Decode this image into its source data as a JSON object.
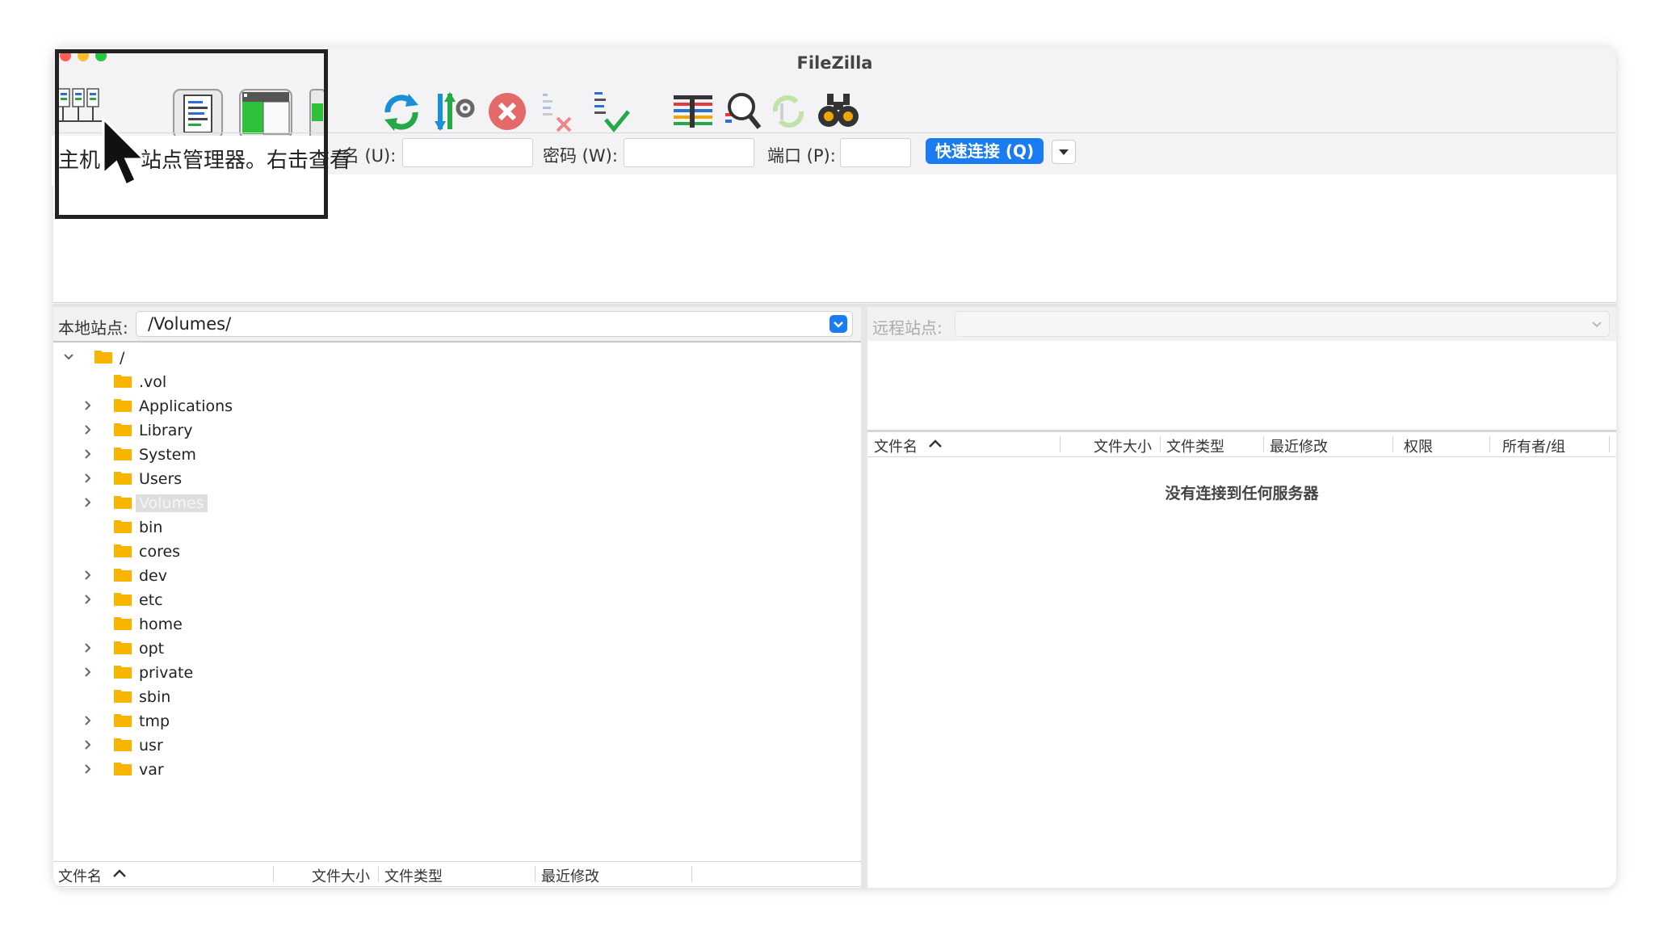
{
  "window": {
    "title": "FileZilla"
  },
  "toolbar": {
    "buttons": [
      {
        "name": "site-manager-button",
        "icon": "site-manager-icon"
      },
      {
        "name": "toggle-message-log-button",
        "icon": "message-log-icon"
      },
      {
        "name": "toggle-directory-tree-button",
        "icon": "directory-tree-icon"
      },
      {
        "name": "toggle-transfer-queue-button",
        "icon": "transfer-queue-icon"
      },
      {
        "name": "refresh-button",
        "icon": "refresh-icon"
      },
      {
        "name": "process-queue-button",
        "icon": "process-queue-icon"
      },
      {
        "name": "cancel-operation-button",
        "icon": "cancel-icon"
      },
      {
        "name": "disconnect-button",
        "icon": "disconnect-icon"
      },
      {
        "name": "reconnect-button",
        "icon": "reconnect-icon"
      },
      {
        "name": "directory-filters-button",
        "icon": "filter-icon"
      },
      {
        "name": "toggle-filename-filter-button",
        "icon": "search-icon"
      },
      {
        "name": "sync-browsing-button",
        "icon": "sync-icon"
      },
      {
        "name": "search-remote-files-button",
        "icon": "binoculars-icon"
      }
    ]
  },
  "tooltip": {
    "host_label": "主机",
    "text": "站点管理器。右击查看"
  },
  "quickconnect": {
    "username_label": "'名 (U):",
    "password_label": "密码 (W):",
    "port_label": "端口 (P):",
    "connect_label": "快速连接 (Q)",
    "username_value": "",
    "password_value": "",
    "port_value": ""
  },
  "local": {
    "site_label": "本地站点:",
    "path": "/Volumes/",
    "tree": [
      {
        "label": "/",
        "level": 0,
        "expanded": true,
        "has_children": true
      },
      {
        "label": ".vol",
        "level": 1,
        "has_children": false
      },
      {
        "label": "Applications",
        "level": 1,
        "has_children": true
      },
      {
        "label": "Library",
        "level": 1,
        "has_children": true
      },
      {
        "label": "System",
        "level": 1,
        "has_children": true
      },
      {
        "label": "Users",
        "level": 1,
        "has_children": true
      },
      {
        "label": "Volumes",
        "level": 1,
        "has_children": true,
        "selected": true
      },
      {
        "label": "bin",
        "level": 1,
        "has_children": false
      },
      {
        "label": "cores",
        "level": 1,
        "has_children": false
      },
      {
        "label": "dev",
        "level": 1,
        "has_children": true
      },
      {
        "label": "etc",
        "level": 1,
        "has_children": true
      },
      {
        "label": "home",
        "level": 1,
        "has_children": false
      },
      {
        "label": "opt",
        "level": 1,
        "has_children": true
      },
      {
        "label": "private",
        "level": 1,
        "has_children": true
      },
      {
        "label": "sbin",
        "level": 1,
        "has_children": false
      },
      {
        "label": "tmp",
        "level": 1,
        "has_children": true
      },
      {
        "label": "usr",
        "level": 1,
        "has_children": true
      },
      {
        "label": "var",
        "level": 1,
        "has_children": true
      }
    ],
    "columns": {
      "name": "文件名",
      "size": "文件大小",
      "type": "文件类型",
      "modified": "最近修改"
    }
  },
  "remote": {
    "site_label": "远程站点:",
    "path": "",
    "columns": {
      "name": "文件名",
      "size": "文件大小",
      "type": "文件类型",
      "modified": "最近修改",
      "permissions": "权限",
      "owner": "所有者/组"
    },
    "empty_message": "没有连接到任何服务器"
  },
  "colors": {
    "accent": "#1a7cf0",
    "folder": "#f7b500",
    "window_bg": "#f3f3f5",
    "highlight_border": "#222222"
  }
}
